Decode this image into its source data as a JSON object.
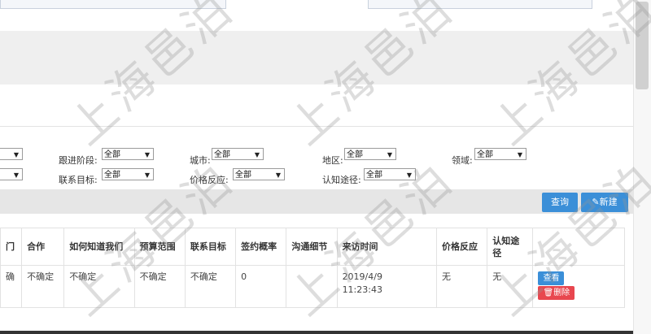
{
  "filters": {
    "stage": {
      "label": "跟进阶段:",
      "value": "全部"
    },
    "contact_target": {
      "label": "联系目标:",
      "value": "全部"
    },
    "city": {
      "label": "城市:",
      "value": "全部"
    },
    "price_response": {
      "label": "价格反应:",
      "value": "全部"
    },
    "region": {
      "label": "地区:",
      "value": "全部"
    },
    "awareness": {
      "label": "认知途径:",
      "value": "全部"
    },
    "field": {
      "label": "领域:",
      "value": "全部"
    }
  },
  "toolbar": {
    "query_label": "查询",
    "new_label": "新建"
  },
  "table": {
    "headers": [
      "门",
      "合作",
      "如何知道我们",
      "预算范围",
      "联系目标",
      "签约概率",
      "沟通细节",
      "来访时间",
      "价格反应",
      "认知途径",
      ""
    ],
    "row": {
      "col0": "确",
      "col1": "不确定",
      "col2": "不确定",
      "col3": "不确定",
      "col4": "不确定",
      "col5": "0",
      "col6": "",
      "col7_date": "2019/4/9",
      "col7_time": "11:23:43",
      "col8": "无",
      "col9": "无",
      "view_label": "查看",
      "delete_label": "删除"
    }
  },
  "watermark": "上海邑泊",
  "colors": {
    "primary": "#3b8fd8",
    "danger": "#e8474f"
  }
}
